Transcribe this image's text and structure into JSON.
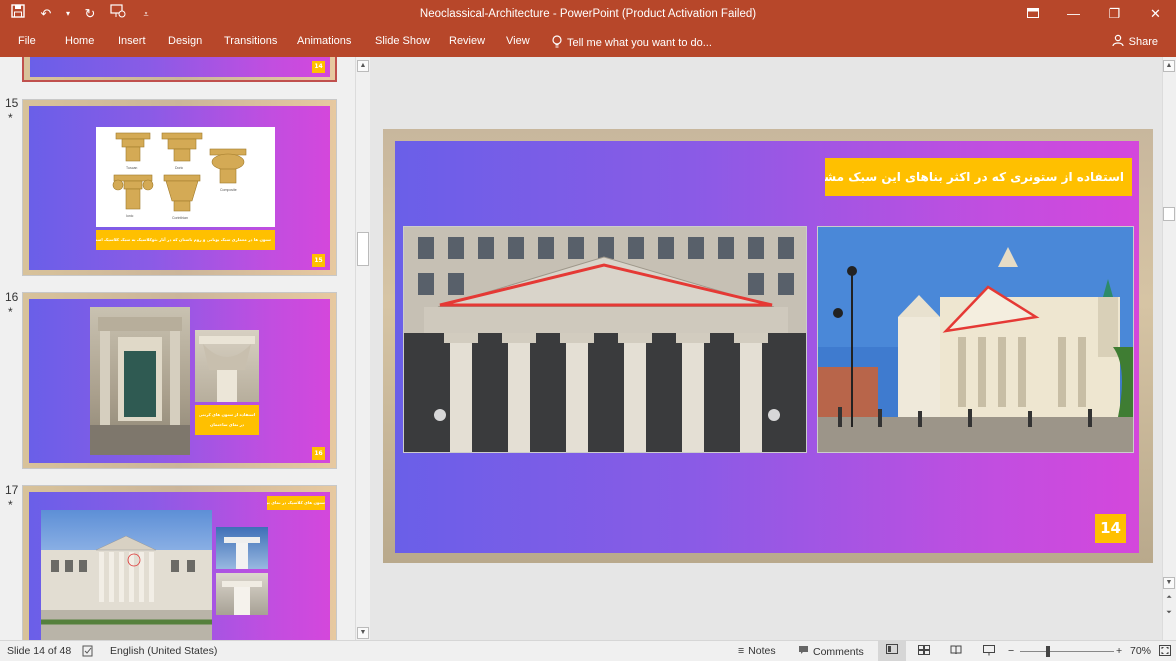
{
  "window": {
    "title": "Neoclassical-Architecture - PowerPoint (Product Activation Failed)",
    "accent": "#b7472a"
  },
  "ribbon": {
    "tabs": [
      "File",
      "Home",
      "Insert",
      "Design",
      "Transitions",
      "Animations",
      "Slide Show",
      "Review",
      "View"
    ],
    "tell_me": "Tell me what you want to do...",
    "share": "Share"
  },
  "thumbnails": {
    "prev_badge": "14",
    "items": [
      {
        "number": "15",
        "star": "*",
        "badge": "15",
        "capitals": [
          "Tuscan",
          "Doric",
          "Composite",
          "Ionic",
          "Corinthian"
        ],
        "caption": "ستون ها در معماری سبک یونانی و روم باستان که در آثار نئوکلاسیک به سبک کلاسیک استفاده شده اند"
      },
      {
        "number": "16",
        "star": "*",
        "badge": "16",
        "caption": "استفاده از ستون های کرنتی در نمای ساختمان"
      },
      {
        "number": "17",
        "star": "*",
        "caption": "ستون های کلاسیک در نمای بیرونی"
      }
    ]
  },
  "slide": {
    "caption": "استفاده از ستونری که در اکثر بناهای این سبک مشاهده میگردد",
    "badge": "14",
    "gradient_colors": [
      "#6a5fe8",
      "#d447dc"
    ],
    "badge_color": "#ffc000"
  },
  "status": {
    "slide_info": "Slide 14 of 48",
    "language": "English (United States)",
    "notes": "Notes",
    "comments": "Comments",
    "zoom": "70%"
  }
}
